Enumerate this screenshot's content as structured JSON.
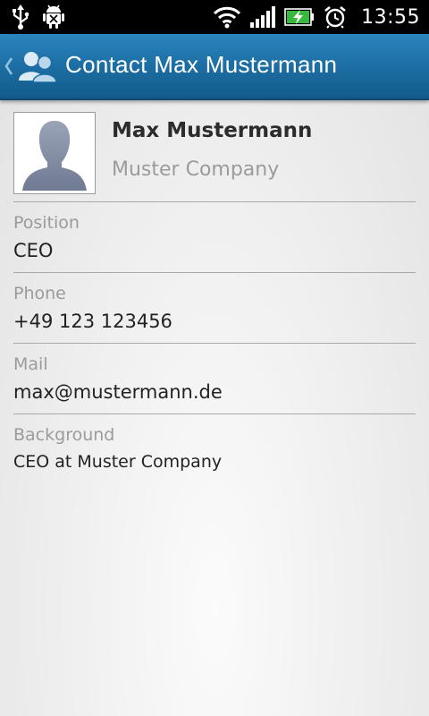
{
  "status_bar": {
    "time": "13:55",
    "left_icons": [
      "usb-icon",
      "android-debug-icon"
    ],
    "right_icons": [
      "wifi-icon",
      "signal-icon",
      "battery-charging-icon",
      "alarm-icon"
    ]
  },
  "action_bar": {
    "title": "Contact Max Mustermann",
    "app_icon": "contacts-icon",
    "back_icon": "back-chevron-icon",
    "color": "#1c6ea4"
  },
  "contact": {
    "name": "Max Mustermann",
    "company": "Muster Company",
    "avatar_icon": "person-silhouette-icon"
  },
  "fields": [
    {
      "label": "Position",
      "value": "CEO"
    },
    {
      "label": "Phone",
      "value": "+49 123 123456"
    },
    {
      "label": "Mail",
      "value": "max@mustermann.de"
    },
    {
      "label": "Background",
      "value": "CEO at Muster Company"
    }
  ]
}
